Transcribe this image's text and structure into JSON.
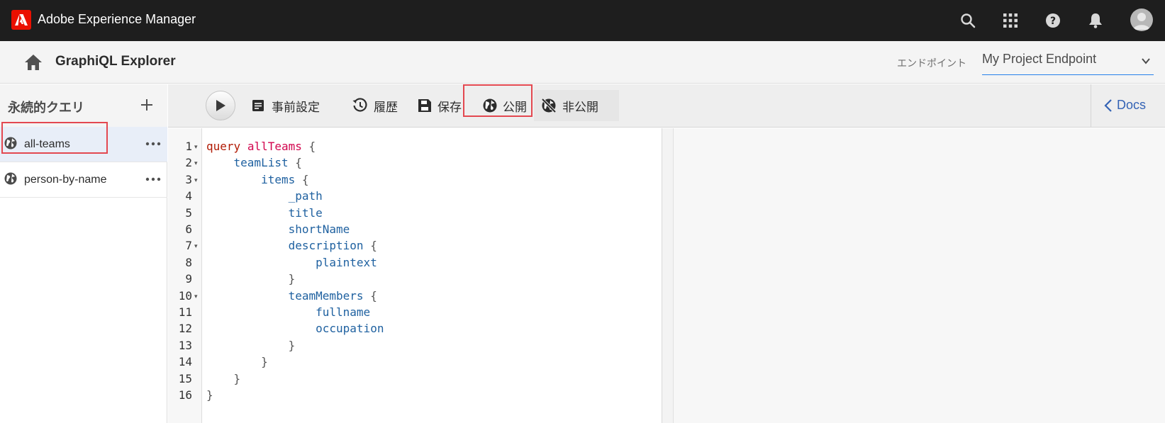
{
  "app": {
    "title": "Adobe Experience Manager"
  },
  "topbar": {
    "icons": [
      "search-icon",
      "apps-grid-icon",
      "help-icon",
      "bell-icon",
      "user-avatar"
    ]
  },
  "header": {
    "title": "GraphiQL Explorer",
    "endpoint_label": "エンドポイント",
    "endpoint_value": "My Project Endpoint"
  },
  "sidebar": {
    "title": "永続的クエリ",
    "items": [
      {
        "label": "all-teams",
        "selected": true
      },
      {
        "label": "person-by-name",
        "selected": false
      }
    ]
  },
  "toolbar": {
    "prettify_label": "事前設定",
    "history_label": "履歴",
    "save_label": "保存",
    "publish_label": "公開",
    "unpublish_label": "非公開",
    "docs_label": "Docs"
  },
  "editor": {
    "line_numbers": [
      "1",
      "2",
      "3",
      "4",
      "5",
      "6",
      "7",
      "8",
      "9",
      "10",
      "11",
      "12",
      "13",
      "14",
      "15",
      "16"
    ],
    "lines": [
      [
        {
          "t": "query",
          "c": "kw"
        },
        {
          "t": " ",
          "c": "punct"
        },
        {
          "t": "allTeams",
          "c": "def"
        },
        {
          "t": " {",
          "c": "punct"
        }
      ],
      [
        {
          "t": "    ",
          "c": "punct"
        },
        {
          "t": "teamList",
          "c": "prop"
        },
        {
          "t": " {",
          "c": "punct"
        }
      ],
      [
        {
          "t": "        ",
          "c": "punct"
        },
        {
          "t": "items",
          "c": "prop"
        },
        {
          "t": " {",
          "c": "punct"
        }
      ],
      [
        {
          "t": "            ",
          "c": "punct"
        },
        {
          "t": "_path",
          "c": "prop"
        }
      ],
      [
        {
          "t": "            ",
          "c": "punct"
        },
        {
          "t": "title",
          "c": "prop"
        }
      ],
      [
        {
          "t": "            ",
          "c": "punct"
        },
        {
          "t": "shortName",
          "c": "prop"
        }
      ],
      [
        {
          "t": "            ",
          "c": "punct"
        },
        {
          "t": "description",
          "c": "prop"
        },
        {
          "t": " {",
          "c": "punct"
        }
      ],
      [
        {
          "t": "                ",
          "c": "punct"
        },
        {
          "t": "plaintext",
          "c": "prop"
        }
      ],
      [
        {
          "t": "            }",
          "c": "punct"
        }
      ],
      [
        {
          "t": "            ",
          "c": "punct"
        },
        {
          "t": "teamMembers",
          "c": "prop"
        },
        {
          "t": " {",
          "c": "punct"
        }
      ],
      [
        {
          "t": "                ",
          "c": "punct"
        },
        {
          "t": "fullname",
          "c": "prop"
        }
      ],
      [
        {
          "t": "                ",
          "c": "punct"
        },
        {
          "t": "occupation",
          "c": "prop"
        }
      ],
      [
        {
          "t": "            }",
          "c": "punct"
        }
      ],
      [
        {
          "t": "        }",
          "c": "punct"
        }
      ],
      [
        {
          "t": "    }",
          "c": "punct"
        }
      ],
      [
        {
          "t": "}",
          "c": "punct"
        }
      ]
    ],
    "foldable_lines": [
      "1",
      "2",
      "3",
      "7",
      "10"
    ]
  }
}
